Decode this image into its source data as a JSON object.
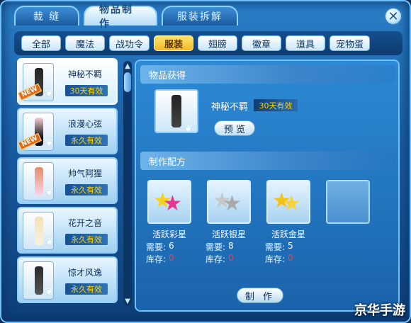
{
  "top_tabs": [
    {
      "label": "裁 缝"
    },
    {
      "label": "物品制作"
    },
    {
      "label": "服装拆解"
    }
  ],
  "close_label": "✕",
  "categories": [
    {
      "label": "全部"
    },
    {
      "label": "魔法"
    },
    {
      "label": "战功令"
    },
    {
      "label": "服装"
    },
    {
      "label": "翅膀"
    },
    {
      "label": "徽章"
    },
    {
      "label": "道具"
    },
    {
      "label": "宠物蛋"
    }
  ],
  "items": [
    {
      "name": "神秘不羁",
      "time": "30天有效",
      "badge": "NEW"
    },
    {
      "name": "浪漫心弦",
      "time": "永久有效",
      "badge": "NEW"
    },
    {
      "name": "帅气阿狸",
      "time": "永久有效",
      "badge": ""
    },
    {
      "name": "花开之音",
      "time": "永久有效",
      "badge": ""
    },
    {
      "name": "惊才风逸",
      "time": "永久有效",
      "badge": ""
    }
  ],
  "obtain": {
    "heading": "物品获得",
    "name": "神秘不羁",
    "time": "30天有效",
    "preview_label": "预 览"
  },
  "recipe": {
    "heading": "制作配方",
    "need_label": "需要:",
    "stock_label": "库存:",
    "materials": [
      {
        "name": "活跃彩星",
        "need": "6",
        "stock": "0"
      },
      {
        "name": "活跃银星",
        "need": "8",
        "stock": "0"
      },
      {
        "name": "活跃金星",
        "need": "5",
        "stock": "0"
      }
    ],
    "make_label": "制 作"
  },
  "watermark": "京华手游"
}
